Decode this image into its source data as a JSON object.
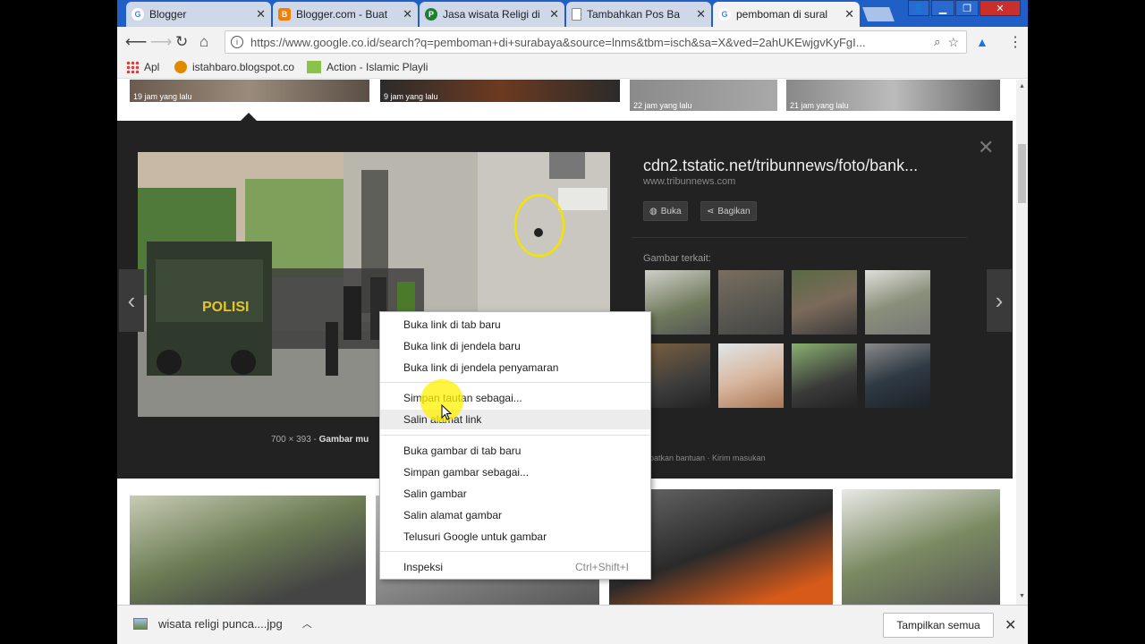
{
  "tabs": [
    {
      "title": "Blogger",
      "icon": "google-g-icon",
      "color": "#4285f4"
    },
    {
      "title": "Blogger.com - Buat",
      "icon": "blogger-icon",
      "color": "#f57d00"
    },
    {
      "title": "Jasa wisata Religi di",
      "icon": "p-icon",
      "color": "#1e7e34"
    },
    {
      "title": "Tambahkan Pos Ba",
      "icon": "document-icon",
      "color": "#888888"
    },
    {
      "title": "pemboman di sural",
      "icon": "google-g-icon",
      "color": "#4285f4"
    }
  ],
  "address": {
    "url": "https://www.google.co.id/search?q=pemboman+di+surabaya&source=lnms&tbm=isch&sa=X&ved=2ahUKEwjgvKyFgI..."
  },
  "bookmarks": [
    {
      "label": "Apl",
      "icon": "apps-grid-icon"
    },
    {
      "label": "istahbaro.blogspot.co",
      "icon": "blogger-icon"
    },
    {
      "label": "Action - Islamic Playli",
      "icon": "playlist-icon"
    }
  ],
  "top_thumbs": [
    {
      "caption": "19 jam yang lalu"
    },
    {
      "caption": "9 jam yang lalu"
    },
    {
      "caption": "22 jam yang lalu"
    },
    {
      "caption": "21 jam yang lalu"
    }
  ],
  "preview": {
    "title": "cdn2.tstatic.net/tribunnews/foto/bank...",
    "domain": "www.tribunnews.com",
    "open_label": "Buka",
    "share_label": "Bagikan",
    "related_label": "Gambar terkait:",
    "dimensions": "700 × 393",
    "caption_prefix": "Gambar mu",
    "help_text": "apatkan bantuan · Kirim masukan",
    "vehicle_text": "POLISI"
  },
  "context_menu": {
    "items": [
      {
        "label": "Buka link di tab baru"
      },
      {
        "label": "Buka link di jendela baru"
      },
      {
        "label": "Buka link di jendela penyamaran"
      },
      {
        "label": "Simpan tautan sebagai..."
      },
      {
        "label": "Salin alamat link"
      },
      {
        "label": "Buka gambar di tab baru"
      },
      {
        "label": "Simpan gambar sebagai..."
      },
      {
        "label": "Salin gambar"
      },
      {
        "label": "Salin alamat gambar"
      },
      {
        "label": "Telusuri Google untuk gambar"
      },
      {
        "label": "Inspeksi",
        "shortcut": "Ctrl+Shift+I"
      }
    ]
  },
  "download": {
    "filename": "wisata religi punca....jpg",
    "show_all": "Tampilkan semua"
  }
}
